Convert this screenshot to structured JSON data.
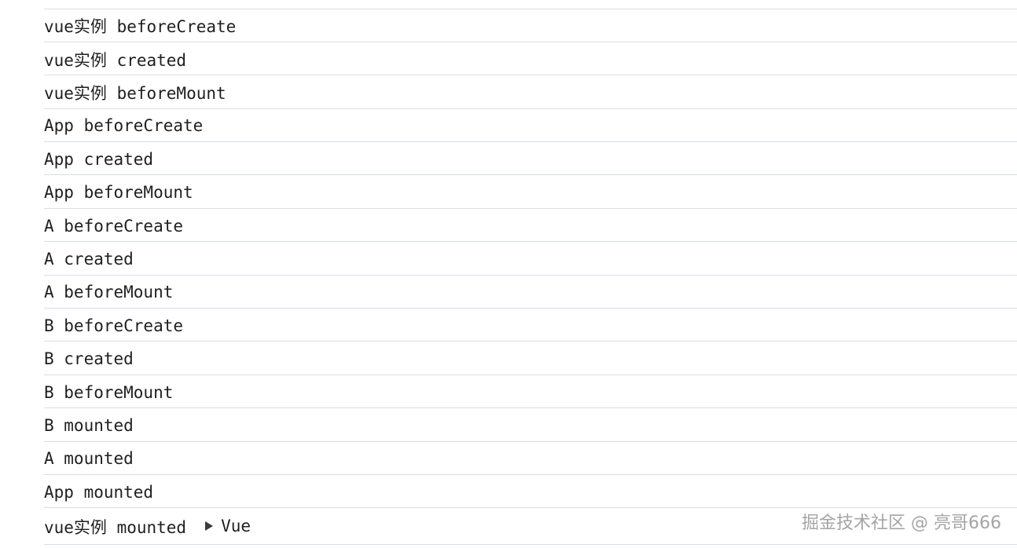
{
  "console": {
    "top_partial_text": "",
    "rows": [
      {
        "text": "vue实例 beforeCreate"
      },
      {
        "text": "vue实例 created"
      },
      {
        "text": "vue实例 beforeMount"
      },
      {
        "text": "App beforeCreate"
      },
      {
        "text": "App created"
      },
      {
        "text": "App beforeMount"
      },
      {
        "text": "A beforeCreate"
      },
      {
        "text": "A created"
      },
      {
        "text": "A beforeMount"
      },
      {
        "text": "B beforeCreate"
      },
      {
        "text": "B created"
      },
      {
        "text": "B beforeMount"
      },
      {
        "text": "B mounted"
      },
      {
        "text": "A mounted"
      },
      {
        "text": "App mounted"
      },
      {
        "text": "vue实例 mounted",
        "object_label": "Vue"
      }
    ]
  },
  "watermark": "掘金技术社区 @ 亮哥666",
  "colors": {
    "divider": "#d5deee",
    "text": "#1f1f1f"
  }
}
